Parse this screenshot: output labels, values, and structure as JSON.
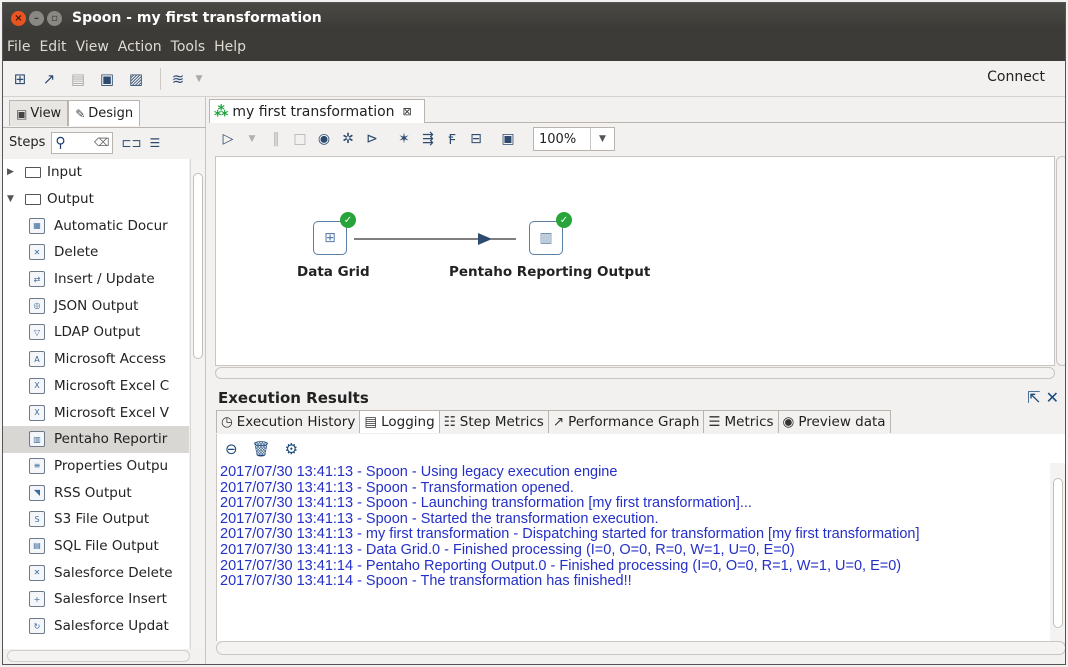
{
  "window": {
    "title": "Spoon - my first transformation"
  },
  "menu": [
    "File",
    "Edit",
    "View",
    "Action",
    "Tools",
    "Help"
  ],
  "toolbar": {
    "connect_label": "Connect"
  },
  "left": {
    "tabs": [
      {
        "label": "View"
      },
      {
        "label": "Design"
      }
    ],
    "steps_label": "Steps",
    "tree": [
      {
        "type": "category",
        "label": "Input",
        "expanded": false
      },
      {
        "type": "category",
        "label": "Output",
        "expanded": true
      },
      {
        "type": "leaf",
        "label": "Automatic Docur"
      },
      {
        "type": "leaf",
        "label": "Delete"
      },
      {
        "type": "leaf",
        "label": "Insert / Update"
      },
      {
        "type": "leaf",
        "label": "JSON Output"
      },
      {
        "type": "leaf",
        "label": "LDAP Output"
      },
      {
        "type": "leaf",
        "label": "Microsoft Access"
      },
      {
        "type": "leaf",
        "label": "Microsoft Excel C"
      },
      {
        "type": "leaf",
        "label": "Microsoft Excel V"
      },
      {
        "type": "leaf",
        "label": "Pentaho Reportir",
        "selected": true
      },
      {
        "type": "leaf",
        "label": "Properties Outpu"
      },
      {
        "type": "leaf",
        "label": "RSS Output"
      },
      {
        "type": "leaf",
        "label": "S3 File Output"
      },
      {
        "type": "leaf",
        "label": "SQL File Output"
      },
      {
        "type": "leaf",
        "label": "Salesforce Delete"
      },
      {
        "type": "leaf",
        "label": "Salesforce Insert"
      },
      {
        "type": "leaf",
        "label": "Salesforce Updat"
      }
    ]
  },
  "editor": {
    "tab_label": "my first transformation",
    "zoom": "100%",
    "steps": [
      {
        "name": "Data Grid"
      },
      {
        "name": "Pentaho Reporting Output"
      }
    ]
  },
  "execution": {
    "title": "Execution Results",
    "tabs": [
      {
        "label": "Execution History"
      },
      {
        "label": "Logging",
        "active": true
      },
      {
        "label": "Step Metrics"
      },
      {
        "label": "Performance Graph"
      },
      {
        "label": "Metrics"
      },
      {
        "label": "Preview data"
      }
    ],
    "log_lines": [
      "2017/07/30 13:41:13 - Spoon - Using legacy execution engine",
      "2017/07/30 13:41:13 - Spoon - Transformation opened.",
      "2017/07/30 13:41:13 - Spoon - Launching transformation [my first transformation]...",
      "2017/07/30 13:41:13 - Spoon - Started the transformation execution.",
      "2017/07/30 13:41:13 - my first transformation - Dispatching started for transformation [my first transformation]",
      "2017/07/30 13:41:13 - Data Grid.0 - Finished processing (I=0, O=0, R=0, W=1, U=0, E=0)",
      "2017/07/30 13:41:14 - Pentaho Reporting Output.0 - Finished processing (I=0, O=0, R=1, W=1, U=0, E=0)",
      "2017/07/30 13:41:14 - Spoon - The transformation has finished!!"
    ]
  }
}
